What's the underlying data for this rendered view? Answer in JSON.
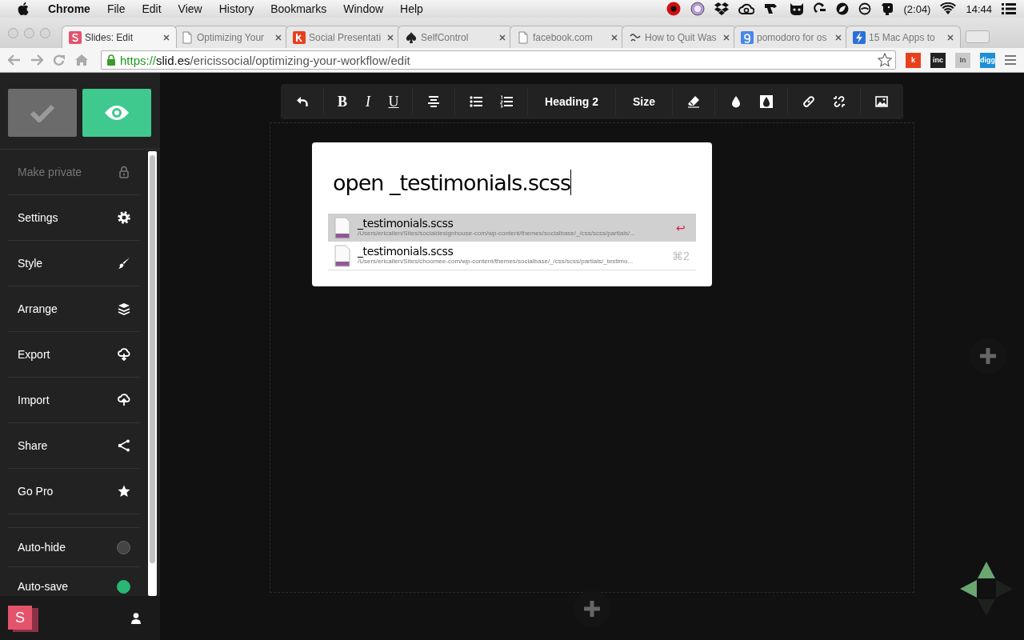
{
  "menu_bar": {
    "app": "Chrome",
    "items": [
      "File",
      "Edit",
      "View",
      "History",
      "Bookmarks",
      "Window",
      "Help"
    ],
    "battery_time": "(2:04)",
    "clock": "14:44"
  },
  "tabs": [
    {
      "title": "Slides: Edit",
      "kind": "slides",
      "selected": true
    },
    {
      "title": "Optimizing Your",
      "kind": "page",
      "selected": false
    },
    {
      "title": "Social Presentati",
      "kind": "k",
      "selected": false
    },
    {
      "title": "SelfControl",
      "kind": "spade",
      "selected": false
    },
    {
      "title": "facebook.com",
      "kind": "page",
      "selected": false
    },
    {
      "title": "How to Quit Was",
      "kind": "curl",
      "selected": false
    },
    {
      "title": "pomodoro for os",
      "kind": "g",
      "selected": false
    },
    {
      "title": "15 Mac Apps to",
      "kind": "bolt",
      "selected": false
    }
  ],
  "address_bar": {
    "scheme": "https://",
    "host": "slid.es",
    "path": "/ericissocial/optimizing-your-workflow/edit"
  },
  "extensions": [
    {
      "label": "k",
      "color": "#e8401c"
    },
    {
      "label": "inc",
      "color": "#222222"
    },
    {
      "label": "In",
      "color": "#c9c9c9"
    },
    {
      "label": "digg",
      "color": "#1d8fd8"
    }
  ],
  "editor_toolbar": [
    {
      "kind": "undo"
    },
    {
      "kind": "bold",
      "label": "B"
    },
    {
      "kind": "italic",
      "label": "I"
    },
    {
      "kind": "underline",
      "label": "U"
    },
    {
      "kind": "align"
    },
    {
      "kind": "bullets"
    },
    {
      "kind": "numbers"
    },
    {
      "kind": "text",
      "label": "Heading 2"
    },
    {
      "kind": "text",
      "label": "Size"
    },
    {
      "kind": "eraser"
    },
    {
      "kind": "drop"
    },
    {
      "kind": "drop-inverse"
    },
    {
      "kind": "link"
    },
    {
      "kind": "unlink"
    },
    {
      "kind": "image"
    }
  ],
  "sidebar": {
    "items": [
      {
        "label": "Make private",
        "kind": "lock",
        "disabled": true
      },
      {
        "label": "Settings",
        "kind": "gear",
        "disabled": false
      },
      {
        "label": "Style",
        "kind": "brush",
        "disabled": false
      },
      {
        "label": "Arrange",
        "kind": "layers",
        "disabled": false
      },
      {
        "label": "Export",
        "kind": "cloud-down",
        "disabled": false
      },
      {
        "label": "Import",
        "kind": "cloud-up",
        "disabled": false
      },
      {
        "label": "Share",
        "kind": "share",
        "disabled": false
      },
      {
        "label": "Go Pro",
        "kind": "star",
        "disabled": false
      }
    ],
    "toggles": [
      {
        "label": "Auto-hide",
        "on": false
      },
      {
        "label": "Auto-save",
        "on": true
      }
    ],
    "logo": "S"
  },
  "quick_open": {
    "query": "open _testimonials.scss",
    "results": [
      {
        "name": "_testimonials.scss",
        "path": "/Users/ericallen/Sites/socialdesignhouse-com/wp-content/themes/socialbase/_/css/scss/partials/...",
        "shortcut": "↩",
        "selected": true
      },
      {
        "name": "_testimonials.scss",
        "path": "/Users/ericallen/Sites/choomee-com/wp-content/themes/socialbase/_/css/scss/partials/_testimo...",
        "shortcut": "⌘2",
        "selected": false
      }
    ]
  },
  "navigation": {
    "up": true,
    "left": true,
    "right": false,
    "down": false
  }
}
